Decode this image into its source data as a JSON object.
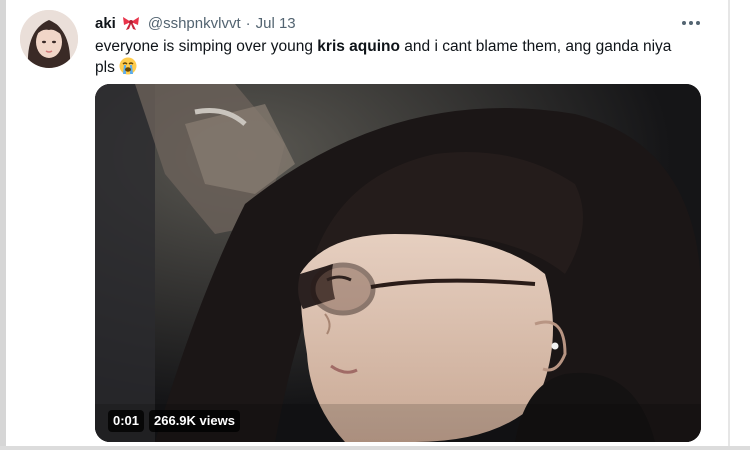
{
  "tweet": {
    "author_name": "aki",
    "handle": "@sshpnkvlvvt",
    "separator": "·",
    "timestamp": "Jul 13",
    "text_before": "everyone is simping over young ",
    "text_bold": "kris aquino",
    "text_after": " and i cant blame them, ang ganda niya pls",
    "author_badge_icon": "ribbon-icon",
    "text_emoji": "loudly-crying-face-icon"
  },
  "video": {
    "current_time": "0:01",
    "views": "266.9K views"
  },
  "colors": {
    "name": "#0f1419",
    "secondary": "#536471",
    "ribbon": "#e8334a",
    "badge_bg": "#000000"
  }
}
